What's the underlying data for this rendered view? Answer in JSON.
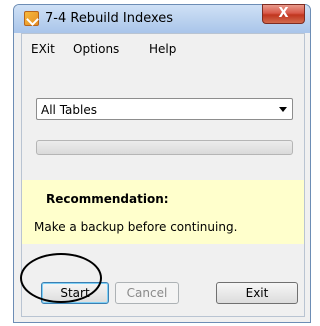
{
  "window": {
    "title": "7-4 Rebuild Indexes",
    "close_glyph": "X",
    "app_icon": "checkmark-app-icon"
  },
  "menu": {
    "items": [
      "EXit",
      "Options",
      "Help"
    ]
  },
  "table_select": {
    "selected": "All Tables"
  },
  "progress": {
    "value_fraction": 0
  },
  "recommendation": {
    "title": "Recommendation:",
    "text": "Make a backup before continuing."
  },
  "buttons": {
    "start": "Start",
    "cancel": "Cancel",
    "exit": "Exit"
  },
  "colors": {
    "title_bar": "#bcd3ef",
    "close_button": "#c1361f",
    "recommendation_bg": "#ffffcc",
    "highlight_ring": "#000000"
  }
}
